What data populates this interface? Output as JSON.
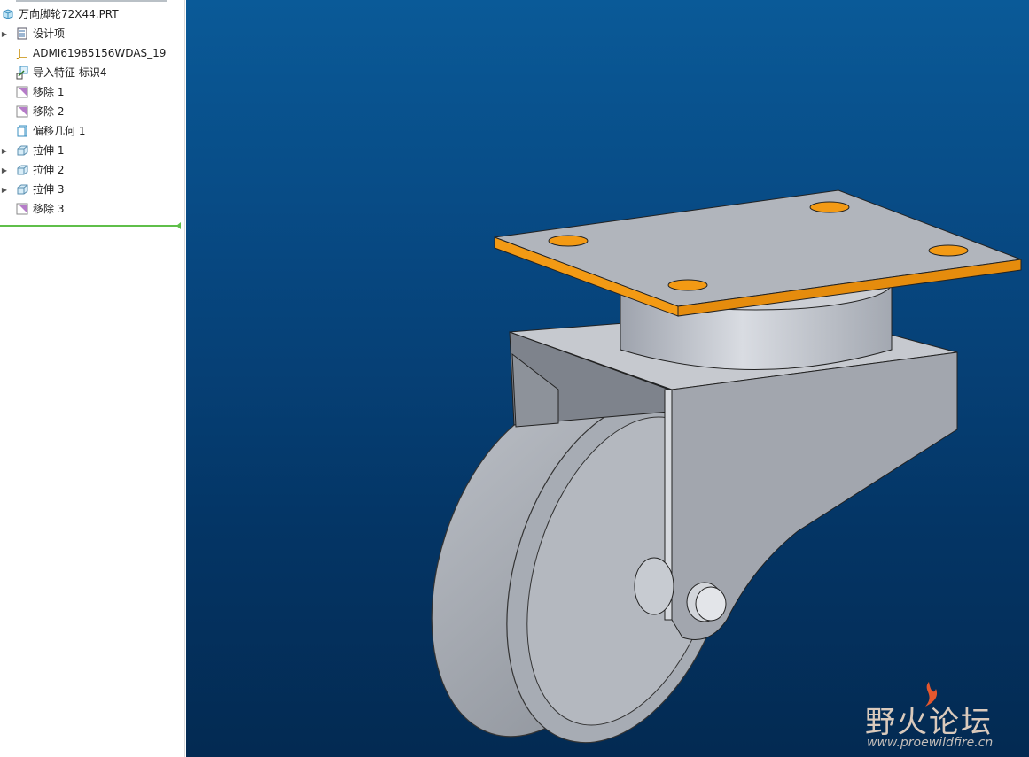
{
  "model_tree": {
    "root": {
      "label": "万向脚轮72X44.PRT",
      "icon": "part-icon"
    },
    "items": [
      {
        "label": "设计项",
        "icon": "design-items-icon",
        "expandable": true
      },
      {
        "label": "ADMI61985156WDAS_19",
        "icon": "coordinate-system-icon",
        "expandable": false
      },
      {
        "label": "导入特征 标识4",
        "icon": "import-feature-icon",
        "expandable": false
      },
      {
        "label": "移除 1",
        "icon": "remove-surface-icon",
        "expandable": false
      },
      {
        "label": "移除 2",
        "icon": "remove-surface-icon",
        "expandable": false
      },
      {
        "label": "偏移几何 1",
        "icon": "offset-geometry-icon",
        "expandable": false
      },
      {
        "label": "拉伸 1",
        "icon": "extrude-icon",
        "expandable": true
      },
      {
        "label": "拉伸 2",
        "icon": "extrude-icon",
        "expandable": true
      },
      {
        "label": "拉伸 3",
        "icon": "extrude-icon",
        "expandable": true
      },
      {
        "label": "移除 3",
        "icon": "remove-surface-icon",
        "expandable": false
      }
    ],
    "insert_indicator_color": "#5fbf4a"
  },
  "viewport": {
    "background_top": "#0a5a98",
    "background_bottom": "#032a52",
    "model_colors": {
      "body": "#a9aeb6",
      "plate_edge": "#f39a14"
    }
  },
  "watermark": {
    "name": "野火论坛",
    "url": "www.proewildfire.cn"
  }
}
